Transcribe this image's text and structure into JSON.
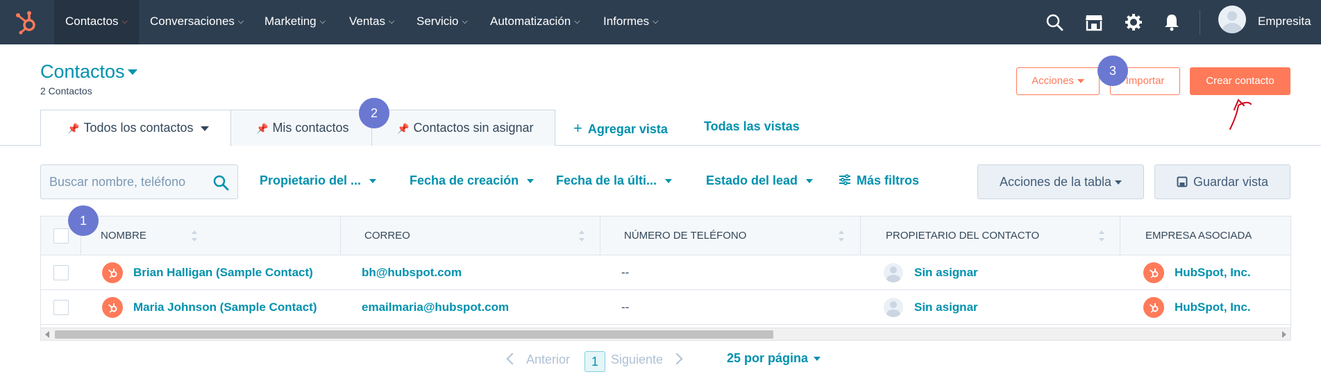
{
  "colors": {
    "nav_bg": "#2d3e50",
    "accent": "#ff7a59",
    "link": "#0091ae",
    "badge": "#6a78d1"
  },
  "nav": {
    "logo": "hubspot-logo",
    "items": [
      {
        "label": "Contactos",
        "active": true
      },
      {
        "label": "Conversaciones"
      },
      {
        "label": "Marketing"
      },
      {
        "label": "Ventas"
      },
      {
        "label": "Servicio"
      },
      {
        "label": "Automatización"
      },
      {
        "label": "Informes"
      }
    ],
    "icons": [
      "search-icon",
      "marketplace-icon",
      "gear-icon",
      "bell-icon"
    ],
    "account": "Empresita"
  },
  "header": {
    "title": "Contactos",
    "count": "2 Contactos",
    "actions_label": "Acciones",
    "import_label": "Importar",
    "create_label": "Crear contacto"
  },
  "badges": [
    "1",
    "2",
    "3"
  ],
  "views": {
    "tabs": [
      "Todos los contactos",
      "Mis contactos",
      "Contactos sin asignar"
    ],
    "add_view": "Agregar vista",
    "all_views": "Todas las vistas"
  },
  "filters": {
    "search_placeholder": "Buscar nombre, teléfono",
    "items": [
      "Propietario del ...",
      "Fecha de creación",
      "Fecha de la últi...",
      "Estado del lead"
    ],
    "more": "Más filtros",
    "table_actions": "Acciones de la tabla",
    "save_view": "Guardar vista"
  },
  "table": {
    "columns": [
      "NOMBRE",
      "CORREO",
      "NÚMERO DE TELÉFONO",
      "PROPIETARIO DEL CONTACTO",
      "EMPRESA ASOCIADA"
    ],
    "rows": [
      {
        "name": "Brian Halligan (Sample Contact)",
        "email": "bh@hubspot.com",
        "phone": "--",
        "owner": "Sin asignar",
        "company": "HubSpot, Inc."
      },
      {
        "name": "Maria Johnson (Sample Contact)",
        "email": "emailmaria@hubspot.com",
        "phone": "--",
        "owner": "Sin asignar",
        "company": "HubSpot, Inc."
      }
    ]
  },
  "pagination": {
    "prev": "Anterior",
    "page": "1",
    "next": "Siguiente",
    "per_page": "25 por página"
  }
}
